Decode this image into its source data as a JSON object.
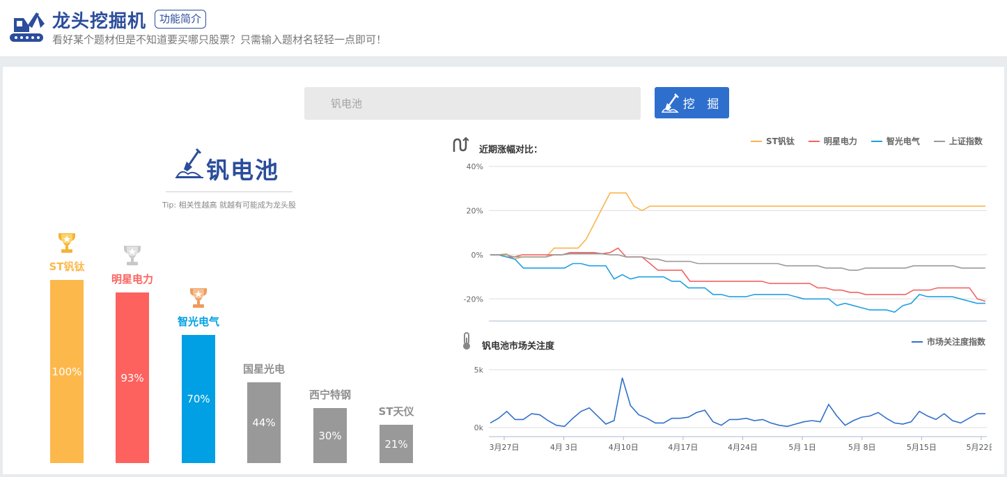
{
  "header": {
    "title": "龙头挖掘机",
    "intro_button": "功能简介",
    "subtitle": "看好某个题材但是不知道要买哪只股票？只需输入题材名轻轻一点即可！"
  },
  "search": {
    "placeholder": "钒电池",
    "button_label": "挖 掘"
  },
  "theme": {
    "name": "钒电池",
    "tip": "Tip:  相关性越高  就越有可能成为龙头股"
  },
  "stocks": [
    {
      "name": "ST钒钛",
      "percent_label": "100%",
      "value": 100,
      "color": "#fdb84b",
      "trophy": "gold-trophy-icon"
    },
    {
      "name": "明星电力",
      "percent_label": "93%",
      "value": 93,
      "color": "#fd625e",
      "trophy": "silver-trophy-icon"
    },
    {
      "name": "智光电气",
      "percent_label": "70%",
      "value": 70,
      "color": "#01a0e4",
      "trophy": "bronze-trophy-icon"
    },
    {
      "name": "国星光电",
      "percent_label": "44%",
      "value": 44,
      "color": "#999999"
    },
    {
      "name": "西宁特钢",
      "percent_label": "30%",
      "value": 30,
      "color": "#999999"
    },
    {
      "name": "ST天仪",
      "percent_label": "21%",
      "value": 21,
      "color": "#999999"
    }
  ],
  "chart_data": [
    {
      "type": "line",
      "title": "近期涨幅对比：",
      "ylim": [
        -30,
        40
      ],
      "yticks": [
        "40%",
        "20%",
        "0%",
        "-20%"
      ],
      "ytick_values": [
        40,
        20,
        0,
        -20
      ],
      "legend_position": "top-right",
      "series": [
        {
          "name": "ST钒钛",
          "color": "#f9b54e",
          "values": [
            0,
            0,
            0.5,
            -2,
            -1,
            -1,
            -1,
            -1,
            3,
            3,
            3,
            3,
            7,
            14,
            21,
            28,
            28,
            28,
            22,
            20,
            22,
            22,
            22,
            22,
            22,
            22,
            22,
            22,
            22,
            22,
            22,
            22,
            22,
            22,
            22,
            22,
            22,
            22,
            22,
            22,
            22,
            22,
            22,
            22,
            22,
            22,
            22,
            22,
            22,
            22,
            22,
            22,
            22,
            22,
            22,
            22,
            22,
            22,
            22,
            22,
            22,
            22,
            22
          ]
        },
        {
          "name": "明星电力",
          "color": "#f26363",
          "values": [
            0,
            0,
            -1,
            -1,
            0,
            0,
            0,
            0,
            0,
            0,
            1,
            1,
            1,
            1,
            0.5,
            1,
            3,
            -1,
            -1,
            -1,
            -4,
            -7,
            -7,
            -7,
            -7,
            -12,
            -12,
            -12,
            -12,
            -12,
            -12,
            -12,
            -12,
            -12,
            -12,
            -13,
            -13,
            -13,
            -13,
            -13,
            -13,
            -15,
            -15,
            -16,
            -16,
            -17,
            -17,
            -18,
            -18,
            -18,
            -18,
            -18,
            -18,
            -16,
            -16,
            -16,
            -15,
            -15,
            -15,
            -15,
            -15,
            -20,
            -21
          ]
        },
        {
          "name": "智光电气",
          "color": "#1ea0e2",
          "values": [
            0,
            0,
            -1,
            -2,
            -6,
            -6,
            -6,
            -6,
            -6,
            -6,
            -4,
            -4,
            -5,
            -5,
            -5,
            -11,
            -9,
            -11,
            -10,
            -10,
            -10,
            -10,
            -12,
            -12,
            -15,
            -15,
            -15,
            -18,
            -18,
            -19,
            -19,
            -19,
            -18,
            -18,
            -18,
            -18,
            -18,
            -19,
            -20,
            -20,
            -20,
            -20,
            -23,
            -22,
            -23,
            -24,
            -25,
            -25,
            -25,
            -26,
            -23,
            -22,
            -18,
            -19,
            -19,
            -19,
            -19,
            -20,
            -21,
            -22,
            -22
          ]
        },
        {
          "name": "上证指数",
          "color": "#999999",
          "values": [
            0,
            0,
            0,
            -1,
            -1,
            -1,
            -1,
            -1,
            0,
            0,
            0.5,
            0.5,
            0.5,
            0.5,
            0.5,
            0,
            0,
            -1,
            -1,
            -1,
            -2,
            -2,
            -3,
            -3,
            -3,
            -3,
            -4,
            -4,
            -4,
            -4,
            -4,
            -4,
            -4,
            -4,
            -4,
            -4,
            -4,
            -5,
            -5,
            -5,
            -5,
            -5,
            -6,
            -6,
            -6,
            -7,
            -7,
            -6,
            -6,
            -6,
            -6,
            -6,
            -6,
            -5,
            -5,
            -5,
            -5,
            -5,
            -5,
            -6,
            -6,
            -6,
            -6
          ]
        }
      ]
    },
    {
      "type": "line",
      "title": "钒电池市场关注度",
      "ylim": [
        0,
        5
      ],
      "yticks": [
        "5k",
        "0k"
      ],
      "ytick_values": [
        5,
        0
      ],
      "legend_position": "top-right",
      "x_labels": [
        "3月27日",
        "4月 3日",
        "4月10日",
        "4月17日",
        "4月24日",
        "5月 1日",
        "5月 8日",
        "5月15日",
        "5月22日"
      ],
      "series": [
        {
          "name": "市场关注度指数",
          "color": "#2f6fc9",
          "values": [
            0.4,
            0.8,
            1.4,
            0.7,
            0.7,
            1.2,
            1.1,
            0.6,
            0.2,
            0.1,
            0.8,
            1.4,
            1.7,
            1.0,
            0.3,
            0.6,
            4.3,
            1.9,
            1.1,
            0.8,
            0.4,
            0.4,
            0.8,
            0.8,
            0.9,
            1.3,
            1.5,
            0.5,
            0.2,
            0.7,
            0.7,
            0.8,
            0.6,
            0.7,
            0.4,
            0.2,
            0.1,
            0.3,
            0.5,
            0.6,
            0.5,
            2.0,
            1.0,
            0.2,
            0.6,
            0.9,
            1.0,
            1.3,
            0.8,
            0.4,
            0.3,
            0.5,
            1.4,
            1.0,
            0.7,
            1.2,
            0.6,
            0.4,
            0.8,
            1.2,
            1.2
          ]
        }
      ]
    }
  ]
}
